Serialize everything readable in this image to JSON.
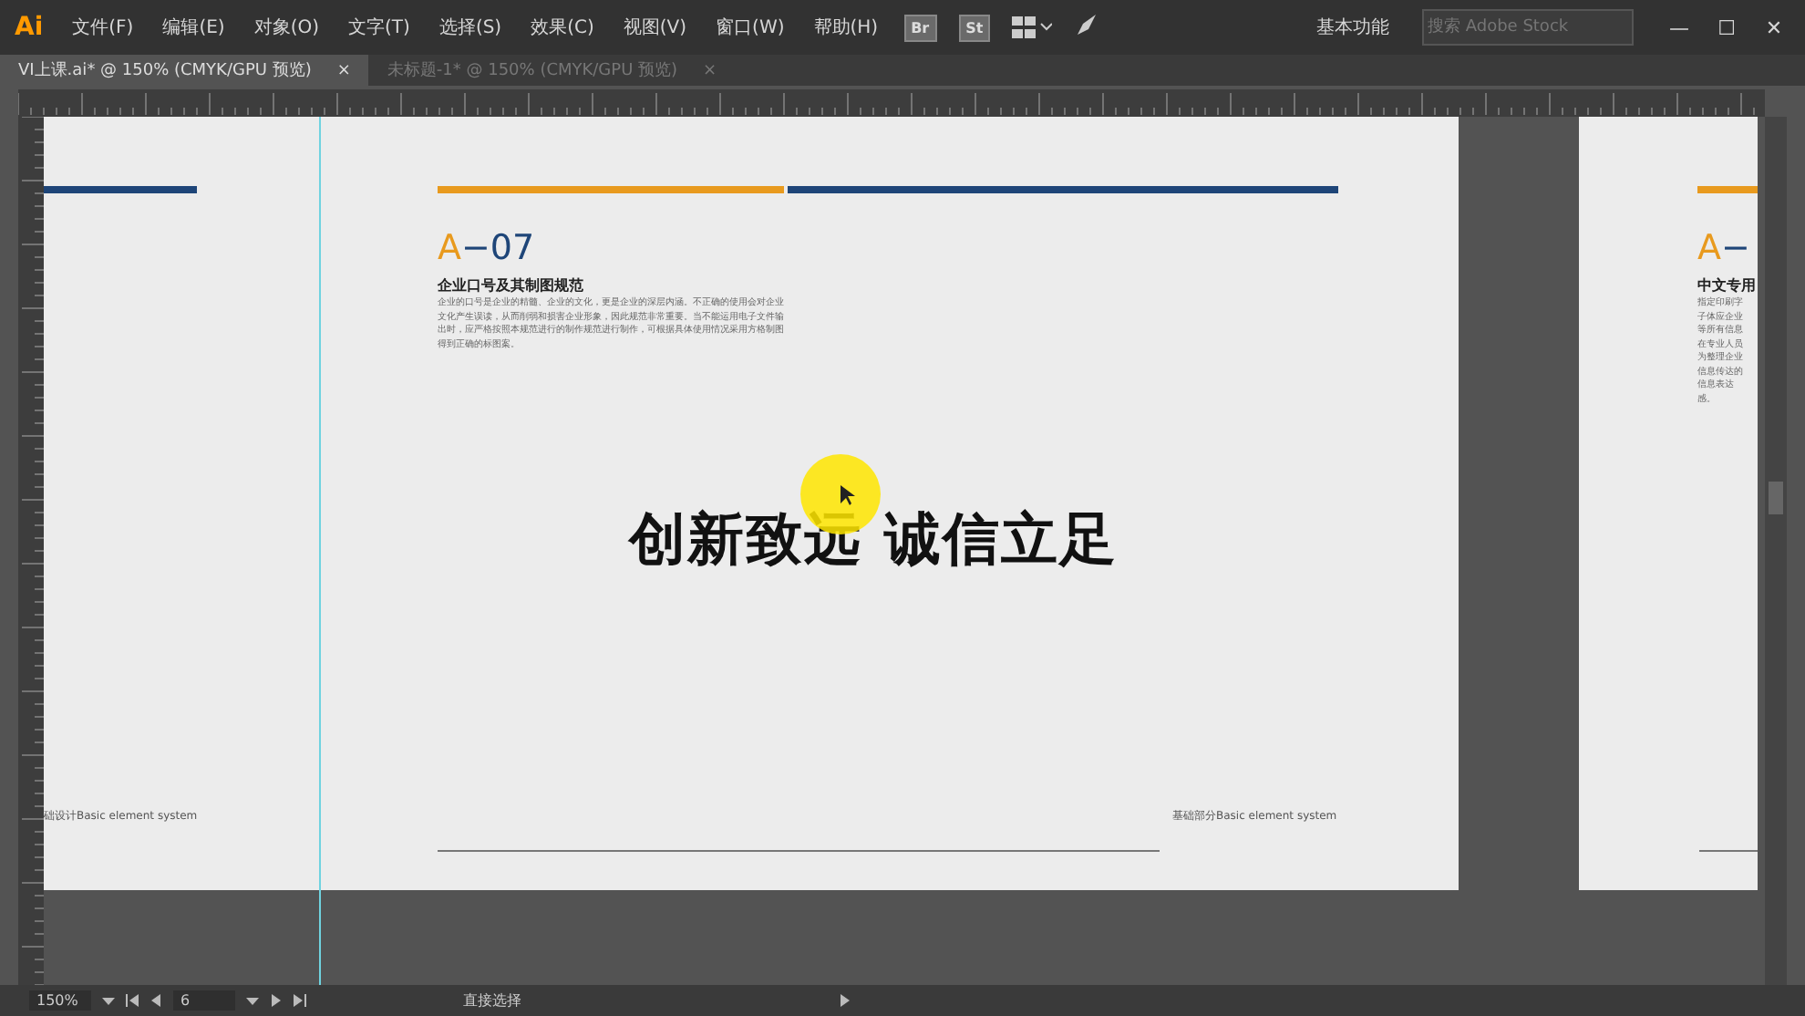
{
  "menu_bar": {
    "app_icon": "Ai",
    "menus": [
      "文件(F)",
      "编辑(E)",
      "对象(O)",
      "文字(T)",
      "选择(S)",
      "效果(C)",
      "视图(V)",
      "窗口(W)",
      "帮助(H)"
    ],
    "bridge_buttons": [
      "Br",
      "St"
    ],
    "workspace": "基本功能",
    "search": {
      "placeholder": "搜索 Adobe Stock"
    },
    "window_controls": [
      "—",
      "☐",
      "✕"
    ]
  },
  "doc_tabs": [
    {
      "label": "VI上课.ai* @ 150% (CMYK/GPU 预览)",
      "close": "×",
      "selected": true
    },
    {
      "label": "未标题-1* @ 150% (CMYK/GPU 预览)",
      "close": "×",
      "selected": false
    }
  ],
  "left_artboard": {
    "footer": "础设计Basic element system"
  },
  "main_artboard": {
    "code": {
      "letter": "A",
      "number": "−07"
    },
    "subtitle": "企业口号及其制图规范",
    "body": "企业的口号是企业的精髓、企业的文化，更是企业的深层内涵。不正确的使用会对企业文化产生误读，从而削弱和损害企业形象，因此规范非常重要。当不能运用电子文件输出时，应严格按照本规范进行的制作规范进行制作，可根据具体使用情况采用方格制图得到正确的标图案。",
    "slogan": [
      "创新致远",
      "诚信立足"
    ],
    "footer": "基础部分Basic element system"
  },
  "right_artboard": {
    "code": {
      "letter": "A",
      "number": "−"
    },
    "subtitle": "中文专用",
    "body_lines": [
      "指定印刷字",
      "子体应企业",
      "等所有信息",
      "在专业人员",
      "为整理企业",
      "信息传达的",
      "信息表达",
      "感。"
    ]
  },
  "status_bar": {
    "zoom": "150%",
    "page": "6",
    "tool": "直接选择"
  }
}
